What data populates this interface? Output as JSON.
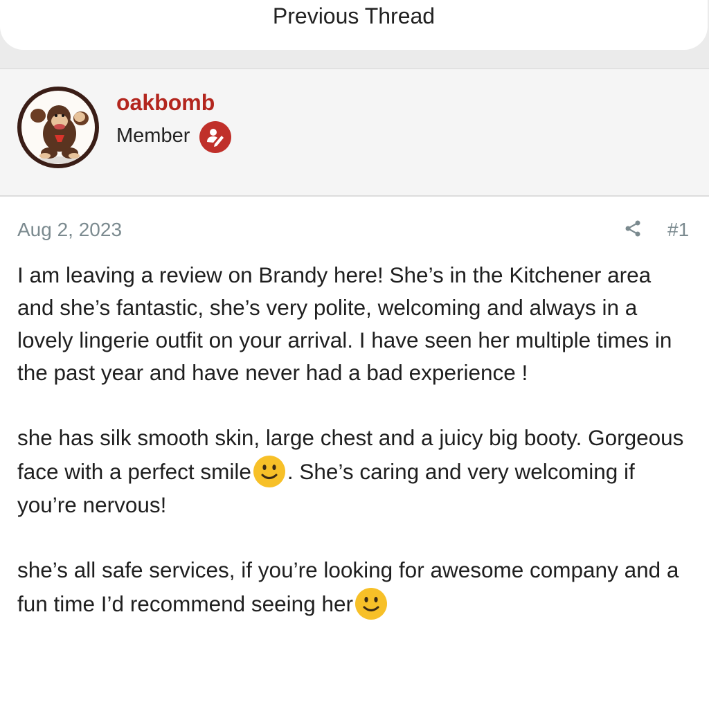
{
  "nav": {
    "previous_thread_label": "Previous Thread"
  },
  "author": {
    "username": "oakbomb",
    "title": "Member",
    "avatar_icon": "gorilla-avatar",
    "badge_icon": "member-badge-icon",
    "username_color": "#b3261e",
    "badge_color": "#c0302a"
  },
  "post": {
    "date": "Aug 2, 2023",
    "number": "#1",
    "share_icon": "share-icon",
    "paragraphs": [
      {
        "parts": [
          "I am leaving a review on Brandy here! She’s in the Kitchener area and she’s fantastic, she’s very polite, welcoming and always in a lovely lingerie outfit on your arrival. I have seen her multiple times in the past year and have never had a bad experience !"
        ]
      },
      {
        "parts": [
          "she has silk smooth skin, large chest and a juicy big booty. Gorgeous face with a perfect smile",
          ". She’s caring and very welcoming if you’re nervous!"
        ],
        "emoji": "slightly-smiling-face"
      },
      {
        "parts": [
          "she’s all safe services, if you’re looking for awesome company and a fun time I’d recommend seeing her"
        ],
        "emoji": "slightly-smiling-face"
      }
    ]
  }
}
